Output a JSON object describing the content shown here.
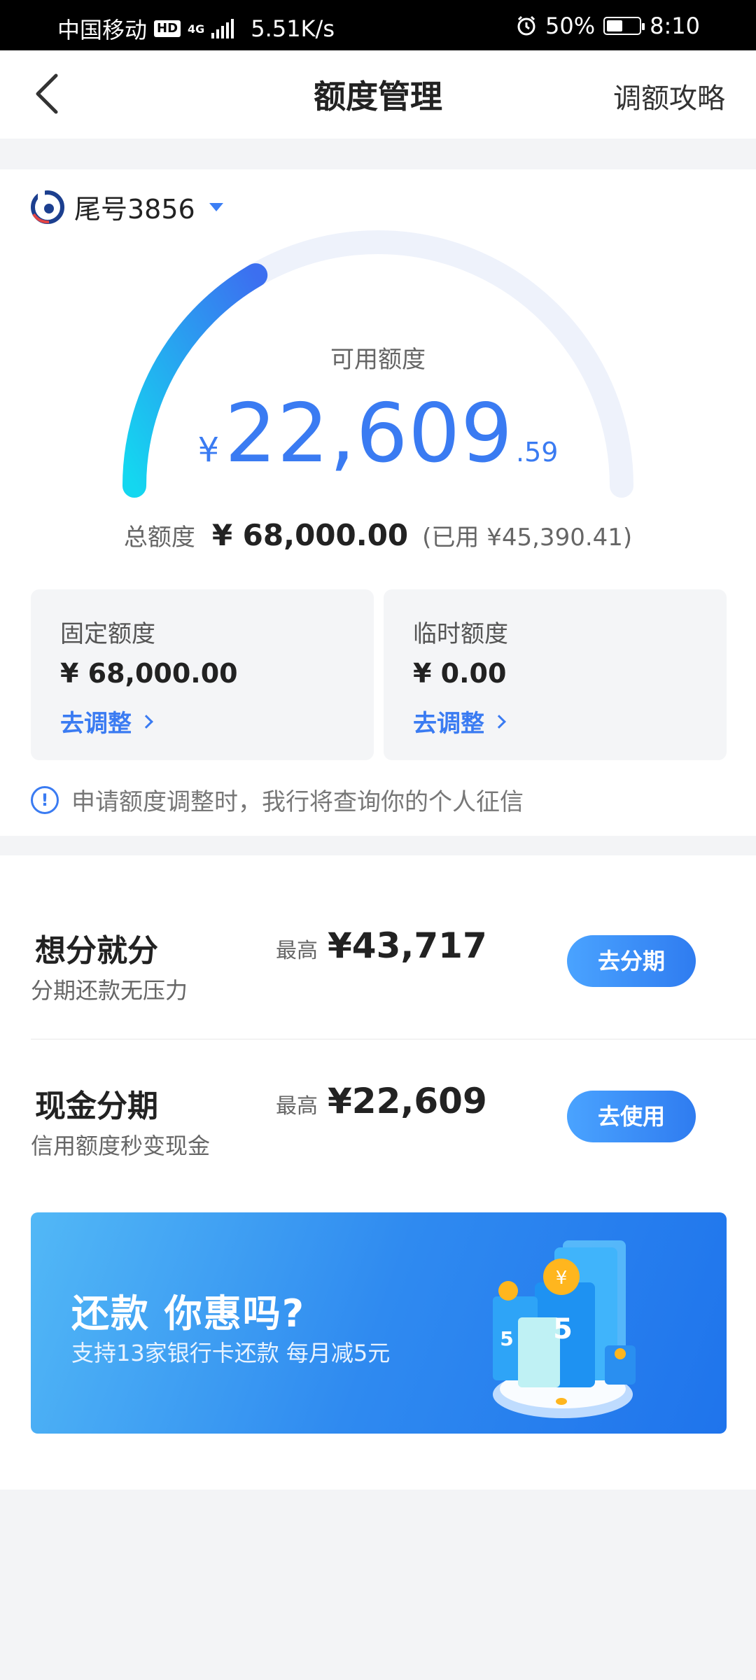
{
  "status_bar": {
    "carrier": "中国移动",
    "hd": "HD",
    "network": "4G",
    "speed": "5.51K/s",
    "battery_pct": "50%",
    "time": "8:10"
  },
  "nav": {
    "title": "额度管理",
    "right_link": "调额攻略"
  },
  "account": {
    "label": "尾号3856"
  },
  "available": {
    "label": "可用额度",
    "currency": "¥",
    "integer": "22,609",
    "decimal": ".59",
    "fraction_of_total": 0.3325
  },
  "total": {
    "label": "总额度",
    "amount": "¥ 68,000.00",
    "used": "(已用 ¥45,390.41)"
  },
  "quota_boxes": [
    {
      "title": "固定额度",
      "amount": "¥ 68,000.00",
      "link": "去调整"
    },
    {
      "title": "临时额度",
      "amount": "¥ 0.00",
      "link": "去调整"
    }
  ],
  "notice": {
    "text": "申请额度调整时，我行将查询你的个人征信"
  },
  "installments": [
    {
      "title": "想分就分",
      "subtitle": "分期还款无压力",
      "max_label": "最高",
      "max_amount": "¥43,717",
      "button": "去分期"
    },
    {
      "title": "现金分期",
      "subtitle": "信用额度秒变现金",
      "max_label": "最高",
      "max_amount": "¥22,609",
      "button": "去使用"
    }
  ],
  "banner": {
    "title": "还款 你惠吗?",
    "subtitle": "支持13家银行卡还款 每月减5元"
  },
  "colors": {
    "accent": "#3a7bf2",
    "gauge_start": "#14d7f0",
    "gauge_end": "#3c6ff0",
    "gauge_track": "#eef2fb"
  }
}
